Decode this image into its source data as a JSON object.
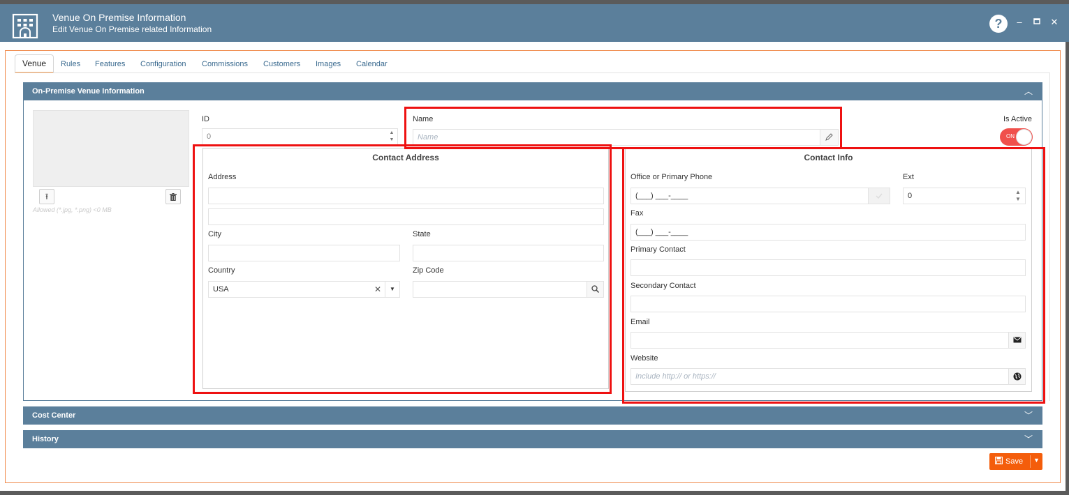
{
  "window": {
    "title": "Venue On Premise Information",
    "subtitle": "Edit Venue On Premise related Information",
    "help_glyph": "?",
    "minimize_glyph": "–",
    "maximize_glyph": "▫",
    "close_glyph": "✕"
  },
  "tabs": [
    {
      "label": "Venue",
      "active": true
    },
    {
      "label": "Rules"
    },
    {
      "label": "Features"
    },
    {
      "label": "Configuration"
    },
    {
      "label": "Commissions"
    },
    {
      "label": "Customers"
    },
    {
      "label": "Images"
    },
    {
      "label": "Calendar"
    }
  ],
  "sections": {
    "venue_info": {
      "title": "On-Premise Venue Information",
      "chevron": "︿"
    },
    "cost_center": {
      "title": "Cost Center",
      "chevron": "﹀"
    },
    "history": {
      "title": "History",
      "chevron": "﹀"
    }
  },
  "image_panel": {
    "upload_glyph": "⭱",
    "delete_glyph": "🗑",
    "allowed_text": "Allowed (*.jpg, *.png) <0 MB"
  },
  "fields": {
    "id": {
      "label": "ID",
      "value": "0"
    },
    "name": {
      "label": "Name",
      "placeholder": "Name",
      "value": ""
    },
    "is_active": {
      "label": "Is Active",
      "state": "ON"
    }
  },
  "contact_address": {
    "title": "Contact Address",
    "address_label": "Address",
    "address1": "",
    "address2": "",
    "city_label": "City",
    "city": "",
    "state_label": "State",
    "state": "",
    "country_label": "Country",
    "country": "USA",
    "country_clear": "✕",
    "country_caret": "▼",
    "zip_label": "Zip Code",
    "zip": ""
  },
  "contact_info": {
    "title": "Contact Info",
    "phone_label": "Office or Primary Phone",
    "phone": "(___) ___-____",
    "ext_label": "Ext",
    "ext": "0",
    "fax_label": "Fax",
    "fax": "(___) ___-____",
    "primary_contact_label": "Primary Contact",
    "primary_contact": "",
    "secondary_contact_label": "Secondary Contact",
    "secondary_contact": "",
    "email_label": "Email",
    "email": "",
    "website_label": "Website",
    "website_placeholder": "Include http:// or https://"
  },
  "actions": {
    "save_label": "Save",
    "save_icon": "💾",
    "save_caret": "▼"
  },
  "colors": {
    "header_bg": "#5b7f9b",
    "accent_orange": "#f45d0b",
    "toggle_on": "#f0504c",
    "highlight_red": "#ee1111"
  }
}
